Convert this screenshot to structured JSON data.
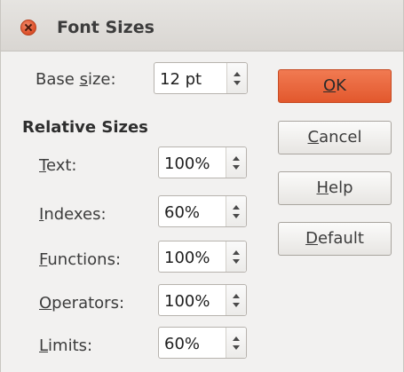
{
  "dialog": {
    "title": "Font Sizes"
  },
  "base": {
    "label_pre": "Base ",
    "label_mn": "s",
    "label_post": "ize:",
    "value": "12 pt"
  },
  "relative": {
    "title": "Relative Sizes",
    "text": {
      "mn": "T",
      "rest": "ext:",
      "value": "100%"
    },
    "indexes": {
      "mn": "I",
      "rest": "ndexes:",
      "value": "60%"
    },
    "functions": {
      "mn": "F",
      "rest": "unctions:",
      "value": "100%"
    },
    "operators": {
      "mn": "O",
      "rest": "perators:",
      "value": "100%"
    },
    "limits": {
      "mn": "L",
      "rest": "imits:",
      "value": "60%"
    }
  },
  "buttons": {
    "ok": {
      "mn": "O",
      "rest": "K"
    },
    "cancel": {
      "mn": "C",
      "rest": "ancel"
    },
    "help": {
      "mn": "H",
      "rest": "elp"
    },
    "default": {
      "mn": "D",
      "rest": "efault"
    }
  },
  "colors": {
    "accent": "#e2582d",
    "window_bg": "#f2f1f0"
  },
  "icons": {
    "close": "close-icon",
    "spin": "spin-arrows-icon"
  }
}
